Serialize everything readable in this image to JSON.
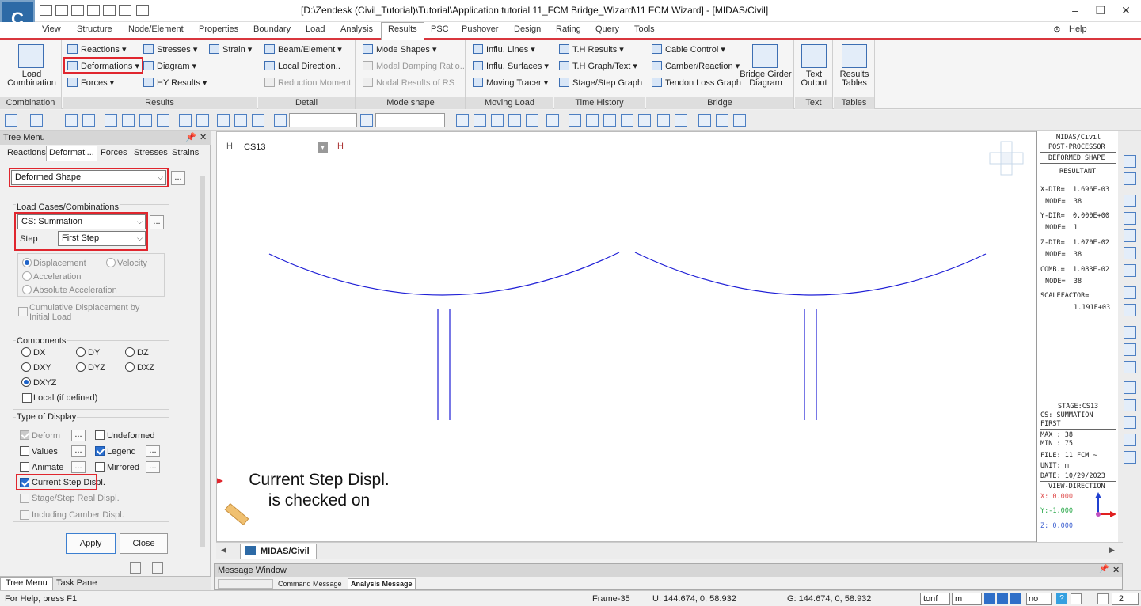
{
  "title_bar": {
    "app_logo": "C",
    "window_title": "[D:\\Zendesk (Civil_Tutorial)\\Tutorial\\Application tutorial 11_FCM Bridge_Wizard\\11 FCM Wizard] - [MIDAS/Civil]"
  },
  "menu_tabs": [
    "View",
    "Structure",
    "Node/Element",
    "Properties",
    "Boundary",
    "Load",
    "Analysis",
    "Results",
    "PSC",
    "Pushover",
    "Design",
    "Rating",
    "Query",
    "Tools"
  ],
  "active_tab": "Results",
  "help_label": "Help",
  "ribbon": {
    "combination": {
      "load_combination": "Load\nCombination",
      "group": "Combination"
    },
    "results": {
      "reactions": "Reactions",
      "deformations": "Deformations",
      "forces": "Forces",
      "stresses": "Stresses",
      "diagram": "Diagram",
      "hy_results": "HY Results",
      "strain": "Strain",
      "group": "Results"
    },
    "detail": {
      "beam_element": "Beam/Element",
      "local_direction": "Local Direction..",
      "reduction_moment": "Reduction Moment",
      "group": "Detail"
    },
    "mode_shape": {
      "mode_shapes": "Mode Shapes",
      "modal_damping": "Modal Damping Ratio..",
      "nodal_results_rs": "Nodal Results of RS",
      "group": "Mode shape"
    },
    "moving_load": {
      "influ_lines": "Influ. Lines",
      "influ_surfaces": "Influ. Surfaces",
      "moving_tracer": "Moving Tracer",
      "group": "Moving Load"
    },
    "time_history": {
      "th_results": "T.H Results",
      "th_graph": "T.H Graph/Text",
      "stage_graph": "Stage/Step Graph",
      "group": "Time History"
    },
    "bridge": {
      "cable_control": "Cable Control",
      "camber": "Camber/Reaction",
      "tendon_loss": "Tendon Loss Graph",
      "bridge_girder": "Bridge Girder\nDiagram",
      "group": "Bridge"
    },
    "text": {
      "text_output": "Text\nOutput",
      "group": "Text"
    },
    "tables": {
      "results_tables": "Results\nTables",
      "group": "Tables"
    }
  },
  "tree_menu": {
    "header": "Tree Menu",
    "tabs": [
      "Reactions",
      "Deformati...",
      "Forces",
      "Stresses",
      "Strains"
    ],
    "active_tab": "Deformati...",
    "deformed_shape": "Deformed Shape",
    "load_cases_title": "Load Cases/Combinations",
    "load_case": "CS: Summation",
    "step_label": "Step",
    "step_value": "First Step",
    "options": [
      "Displacement",
      "Velocity",
      "Acceleration",
      "Absolute Acceleration"
    ],
    "cumulative": "Cumulative Displacement by Initial Load",
    "components_title": "Components",
    "components": [
      "DX",
      "DY",
      "DZ",
      "DXY",
      "DYZ",
      "DXZ",
      "DXYZ"
    ],
    "selected_component": "DXYZ",
    "local_if_defined": "Local (if defined)",
    "type_of_display_title": "Type of Display",
    "display": {
      "deform": "Deform",
      "undeformed": "Undeformed",
      "values": "Values",
      "legend": "Legend",
      "animate": "Animate",
      "mirrored": "Mirrored",
      "current_step": "Current Step Displ.",
      "stage_real": "Stage/Step Real Displ.",
      "including_camber": "Including Camber Displ."
    },
    "apply": "Apply",
    "close": "Close",
    "bottom_tabs": [
      "Tree Menu",
      "Task Pane"
    ]
  },
  "view": {
    "stage_combo": "CS13",
    "annotation": "Current Step Displ.\nis checked on",
    "line_color": "#1f1fd6"
  },
  "legend_panel": {
    "lines": [
      "MIDAS/Civil",
      "POST-PROCESSOR",
      "DEFORMED SHAPE",
      "RESULTANT",
      "X-DIR=  1.696E-03",
      "NODE=  38",
      "Y-DIR=  0.000E+00",
      "NODE=  1",
      "Z-DIR=  1.070E-02",
      "NODE=  38",
      "COMB.=  1.083E-02",
      "NODE=  38",
      "SCALEFACTOR=",
      "1.191E+03",
      "STAGE:CS13",
      "CS: SUMMATION",
      "FIRST",
      "MAX : 38",
      "MIN : 75",
      "FILE: 11 FCM ~",
      "UNIT: m",
      "DATE: 10/29/2023",
      "VIEW-DIRECTION",
      "X: 0.000",
      "Y:-1.000",
      "Z: 0.000"
    ]
  },
  "doc_tab": "MIDAS/Civil",
  "message_window": {
    "title": "Message Window",
    "tabs": [
      "Command Message",
      "Analysis Message"
    ]
  },
  "status_bar": {
    "help": "For Help, press F1",
    "frame": "Frame-35",
    "u_coord": "U: 144.674, 0, 58.932",
    "g_coord": "G: 144.674, 0, 58.932",
    "force_unit": "tonf",
    "length_unit": "m",
    "mode": "no",
    "page_num": "2"
  }
}
